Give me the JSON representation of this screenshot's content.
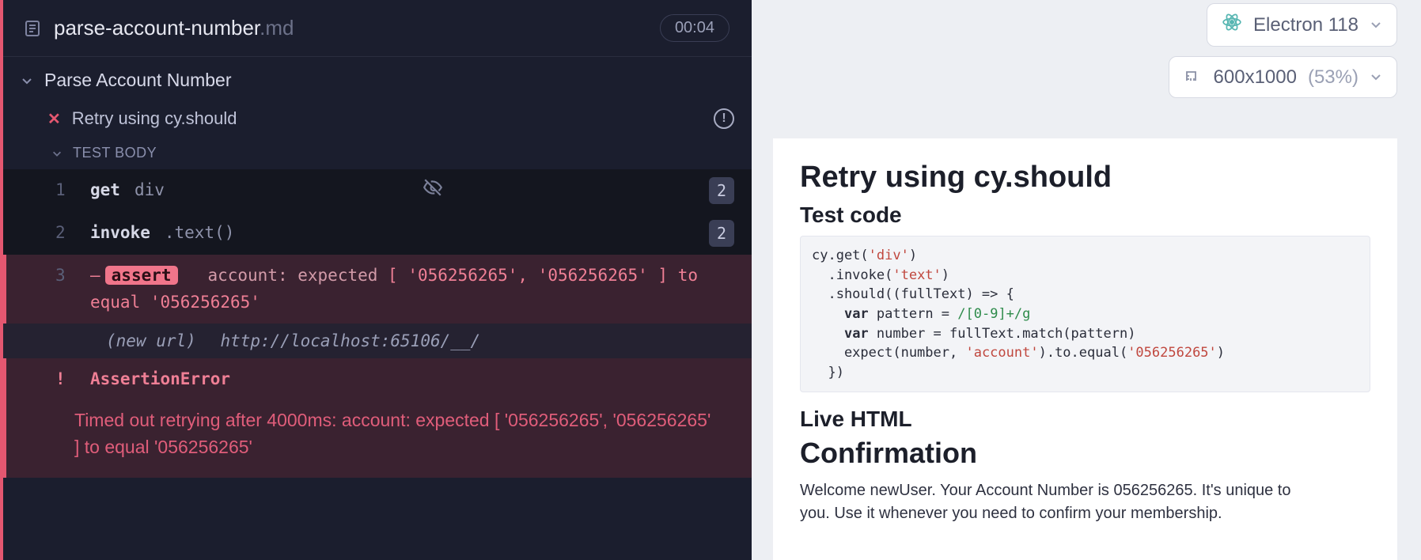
{
  "header": {
    "file_name": "parse-account-number",
    "file_ext": ".md",
    "timer": "00:04"
  },
  "suite": {
    "title": "Parse Account Number"
  },
  "test": {
    "title": "Retry using cy.should"
  },
  "section": {
    "label": "TEST BODY"
  },
  "log": {
    "r1": {
      "n": "1",
      "cmd": "get",
      "arg": "div",
      "badge": "2"
    },
    "r2": {
      "n": "2",
      "cmd": "invoke",
      "arg": ".text()",
      "badge": "2"
    },
    "r3": {
      "n": "3",
      "pill": "assert",
      "pre": "account: expected ",
      "arr": "[ '056256265', '056256265' ]",
      "mid": " to equal ",
      "val": "'056256265'"
    },
    "url": {
      "label": "(new url)",
      "value": "http://localhost:65106/__/"
    }
  },
  "error": {
    "title": "AssertionError",
    "body": "Timed out retrying after 4000ms: account: expected [ '056256265', '056256265' ] to equal '056256265'"
  },
  "controls": {
    "browser": "Electron 118",
    "viewport": "600x1000",
    "scale": "(53%)"
  },
  "app": {
    "h1": "Retry using cy.should",
    "h2": "Test code",
    "code": {
      "l1a": "cy.get(",
      "l1s": "'div'",
      "l1b": ")",
      "l2a": "  .invoke(",
      "l2s": "'text'",
      "l2b": ")",
      "l3": "  .should((fullText) => {",
      "l4a": "    ",
      "l4k": "var",
      "l4b": " pattern = ",
      "l4r": "/[0-9]+/g",
      "l5a": "    ",
      "l5k": "var",
      "l5b": " number = fullText.match(pattern)",
      "l6a": "    expect(number, ",
      "l6s1": "'account'",
      "l6b": ").to.equal(",
      "l6s2": "'056256265'",
      "l6c": ")",
      "l7": "  })"
    },
    "h2b": "Live HTML",
    "h1b": "Confirmation",
    "para": "Welcome newUser. Your Account Number is 056256265. It's unique to you. Use it whenever you need to confirm your membership."
  }
}
